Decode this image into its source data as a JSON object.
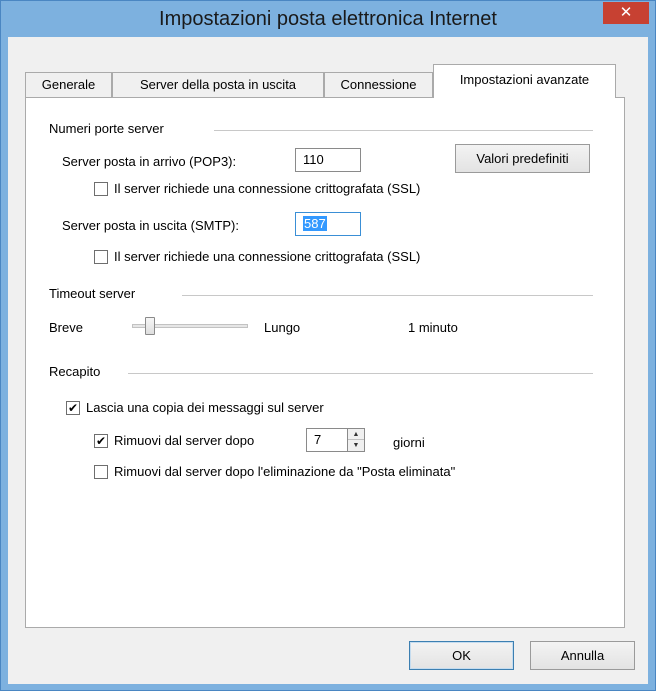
{
  "window": {
    "title": "Impostazioni posta elettronica Internet",
    "close_glyph": "✕"
  },
  "tabs": [
    {
      "label": "Generale"
    },
    {
      "label": "Server della posta in uscita"
    },
    {
      "label": "Connessione"
    },
    {
      "label": "Impostazioni avanzate"
    }
  ],
  "ports": {
    "group_label": "Numeri porte server",
    "incoming_label": "Server posta in arrivo (POP3):",
    "incoming_value": "110",
    "defaults_button": "Valori predefiniti",
    "incoming_ssl_label": "Il server richiede una connessione crittografata (SSL)",
    "outgoing_label": "Server posta in uscita (SMTP):",
    "outgoing_value": "587",
    "outgoing_ssl_label": "Il server richiede una connessione crittografata (SSL)"
  },
  "timeout": {
    "group_label": "Timeout server",
    "short_label": "Breve",
    "long_label": "Lungo",
    "value_text": "1 minuto"
  },
  "delivery": {
    "group_label": "Recapito",
    "leave_copy_label": "Lascia una copia dei messaggi sul server",
    "remove_after_label": "Rimuovi dal server dopo",
    "days_value": "7",
    "days_label": "giorni",
    "remove_deleted_label": "Rimuovi dal server dopo l'eliminazione da \"Posta eliminata\""
  },
  "footer": {
    "ok": "OK",
    "cancel": "Annulla"
  },
  "state": {
    "incoming_ssl": false,
    "outgoing_ssl": false,
    "leave_copy": true,
    "remove_after": true,
    "remove_deleted": false,
    "timeout_slider_fraction": 0.12
  }
}
